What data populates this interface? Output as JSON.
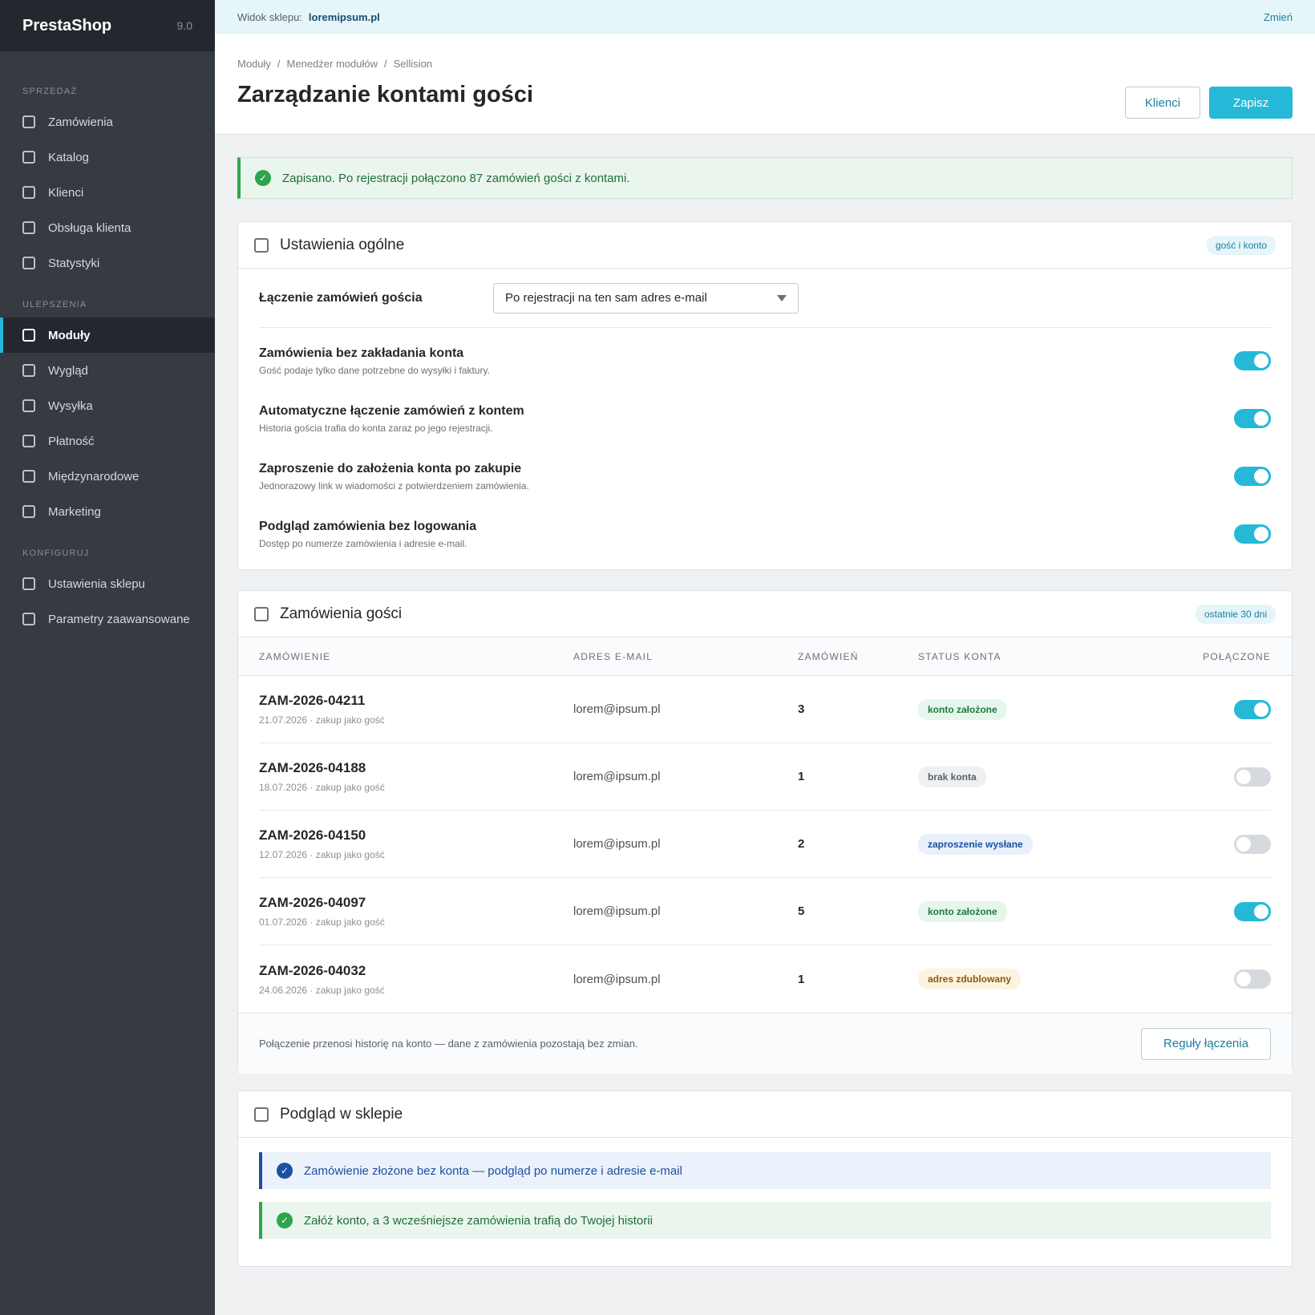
{
  "brand": {
    "name": "PrestaShop",
    "version": "9.0"
  },
  "sidebar": {
    "sections": [
      {
        "title": "SPRZEDAŻ",
        "items": [
          "Zamówienia",
          "Katalog",
          "Klienci",
          "Obsługa klienta",
          "Statystyki"
        ]
      },
      {
        "title": "ULEPSZENIA",
        "items": [
          "Moduły",
          "Wygląd",
          "Wysyłka",
          "Płatność",
          "Międzynarodowe",
          "Marketing"
        ]
      },
      {
        "title": "KONFIGURUJ",
        "items": [
          "Ustawienia sklepu",
          "Parametry zaawansowane"
        ]
      }
    ],
    "active": "Moduły"
  },
  "topbar": {
    "label": "Widok sklepu:",
    "shop": "loremipsum.pl",
    "change": "Zmień"
  },
  "header": {
    "breadcrumbs": [
      "Moduły",
      "Menedżer modułów",
      "Sellision"
    ],
    "title": "Zarządzanie kontami gości",
    "btn_clients": "Klienci",
    "btn_save": "Zapisz"
  },
  "alert": {
    "text": "Zapisano. Po rejestracji połączono 87 zamówień gości z kontami."
  },
  "general": {
    "title": "Ustawienia ogólne",
    "pill": "gość i konto",
    "select_label": "Łączenie zamówień gościa",
    "select_value": "Po rejestracji na ten sam adres e-mail",
    "settings": [
      {
        "title": "Zamówienia bez zakładania konta",
        "desc": "Gość podaje tylko dane potrzebne do wysyłki i faktury.",
        "on": true
      },
      {
        "title": "Automatyczne łączenie zamówień z kontem",
        "desc": "Historia gościa trafia do konta zaraz po jego rejestracji.",
        "on": true
      },
      {
        "title": "Zaproszenie do założenia konta po zakupie",
        "desc": "Jednorazowy link w wiadomości z potwierdzeniem zamówienia.",
        "on": true
      },
      {
        "title": "Podgląd zamówienia bez logowania",
        "desc": "Dostęp po numerze zamówienia i adresie e-mail.",
        "on": true
      }
    ]
  },
  "orders": {
    "title": "Zamówienia gości",
    "pill": "ostatnie 30 dni",
    "columns": [
      "ZAMÓWIENIE",
      "ADRES E-MAIL",
      "ZAMÓWIEŃ",
      "STATUS KONTA",
      "POŁĄCZONE"
    ],
    "rows": [
      {
        "id": "ZAM-2026-04211",
        "meta": "21.07.2026 · zakup jako gość",
        "email": "lorem@ipsum.pl",
        "count": "3",
        "status": "konto założone",
        "status_kind": "green",
        "linked": true
      },
      {
        "id": "ZAM-2026-04188",
        "meta": "18.07.2026 · zakup jako gość",
        "email": "lorem@ipsum.pl",
        "count": "1",
        "status": "brak konta",
        "status_kind": "grey",
        "linked": false
      },
      {
        "id": "ZAM-2026-04150",
        "meta": "12.07.2026 · zakup jako gość",
        "email": "lorem@ipsum.pl",
        "count": "2",
        "status": "zaproszenie wysłane",
        "status_kind": "blue",
        "linked": false
      },
      {
        "id": "ZAM-2026-04097",
        "meta": "01.07.2026 · zakup jako gość",
        "email": "lorem@ipsum.pl",
        "count": "5",
        "status": "konto założone",
        "status_kind": "green",
        "linked": true
      },
      {
        "id": "ZAM-2026-04032",
        "meta": "24.06.2026 · zakup jako gość",
        "email": "lorem@ipsum.pl",
        "count": "1",
        "status": "adres zdublowany",
        "status_kind": "amber",
        "linked": false
      }
    ],
    "footer_note": "Połączenie przenosi historię na konto — dane z zamówienia pozostają bez zmian.",
    "btn_rules": "Reguły łączenia"
  },
  "preview": {
    "title": "Podgląd w sklepie",
    "info": "Zamówienie złożone bez konta — podgląd po numerze i adresie e-mail",
    "ok": "Załóż konto, a 3 wcześniejsze zamówienia trafią do Twojej historii"
  },
  "colors": {
    "accent": "#25b9d7",
    "sidebar": "#363a41",
    "success": "#2ea44f",
    "info": "#1c4fa0"
  }
}
